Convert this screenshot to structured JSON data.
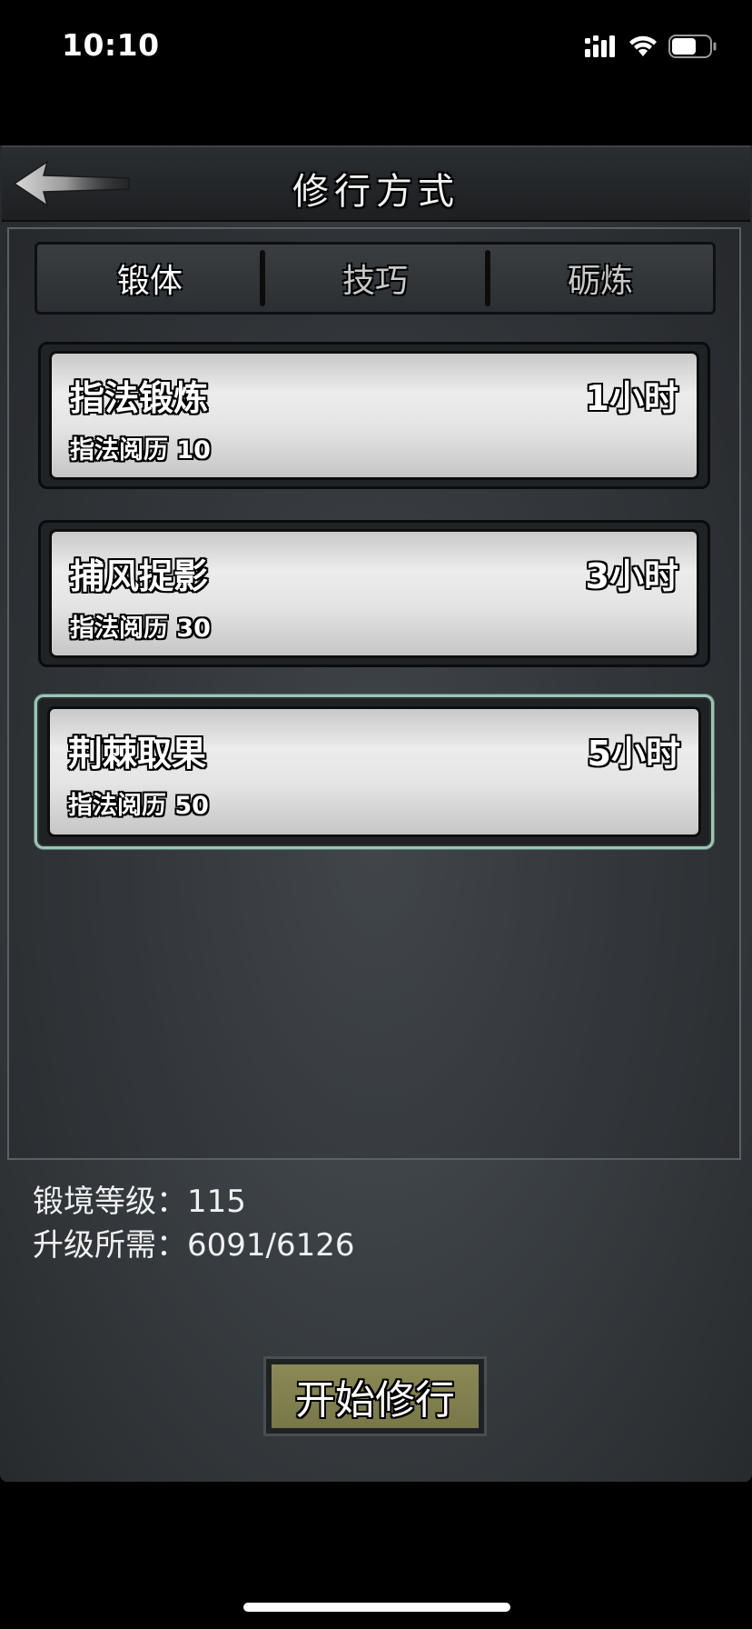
{
  "status_bar": {
    "time": "10:10",
    "icons": [
      "cellular-signal-icon",
      "wifi-icon",
      "battery-icon"
    ]
  },
  "header": {
    "title": "修行方式",
    "back_icon": "back-arrow-icon"
  },
  "tabs": [
    {
      "label": "锻体",
      "active": true
    },
    {
      "label": "技巧",
      "active": false
    },
    {
      "label": "砺炼",
      "active": false
    }
  ],
  "trainings": [
    {
      "name": "指法锻炼",
      "duration": "1小时",
      "reward": "指法阅历 10",
      "selected": false
    },
    {
      "name": "捕风捉影",
      "duration": "3小时",
      "reward": "指法阅历 30",
      "selected": false
    },
    {
      "name": "荆棘取果",
      "duration": "5小时",
      "reward": "指法阅历 50",
      "selected": true
    }
  ],
  "stats": {
    "level_label": "锻境等级：",
    "level_value": "115",
    "upgrade_label": "升级所需：",
    "upgrade_value": "6091/6126"
  },
  "start_button": {
    "label": "开始修行"
  },
  "colors": {
    "selected_border": "#9cc5b6",
    "start_button_fill": "#8b8a55",
    "panel_bg": "#3a3f43"
  }
}
